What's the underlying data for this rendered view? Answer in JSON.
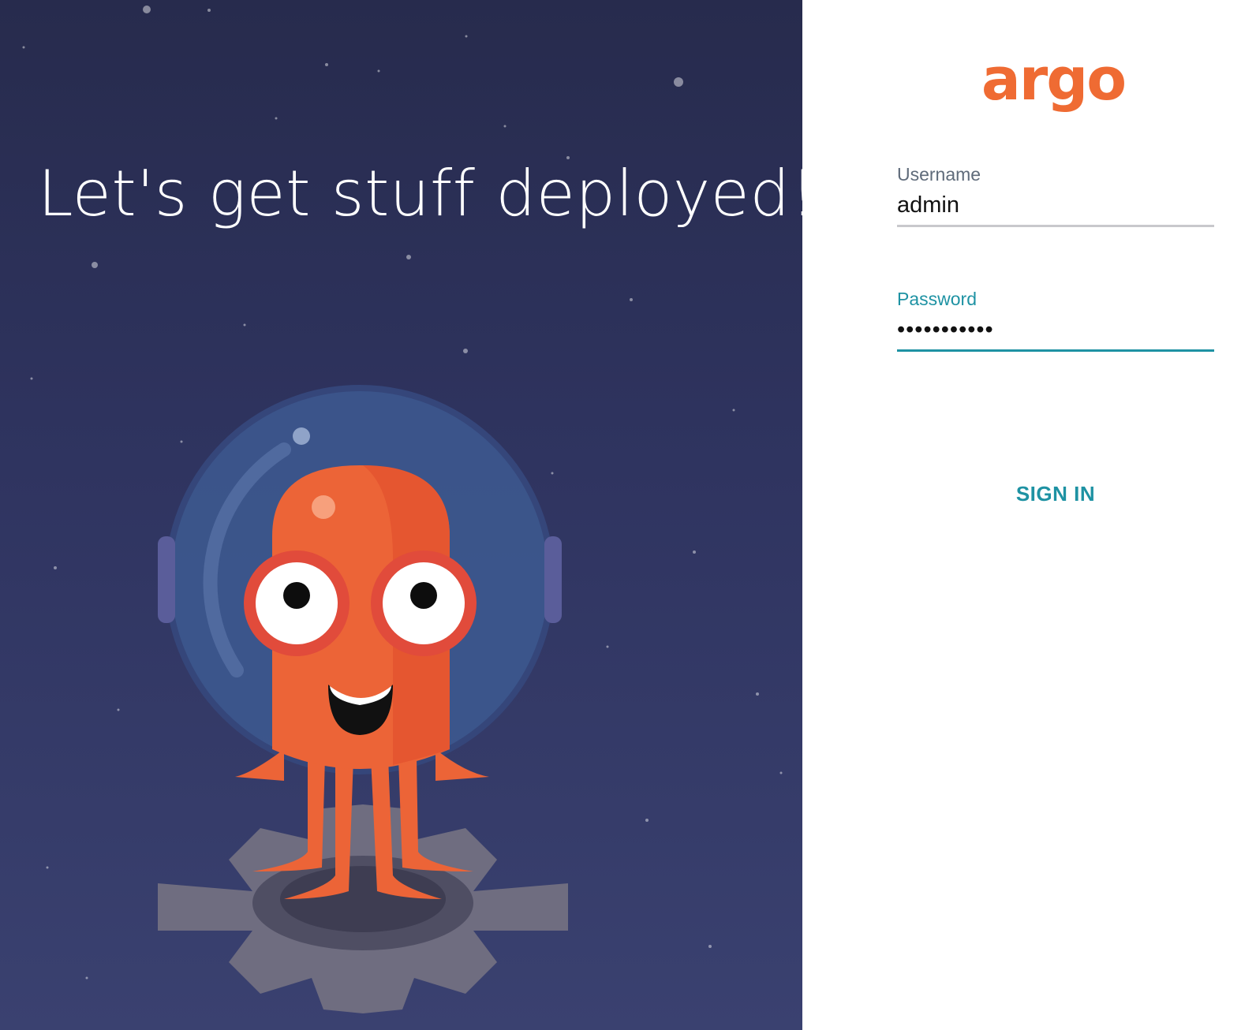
{
  "hero": {
    "title": "Let's get stuff deployed!"
  },
  "brand": {
    "logo_text": "argo",
    "accent": "#ef6b33"
  },
  "form": {
    "username_label": "Username",
    "username_value": "admin",
    "password_label": "Password",
    "password_value": "•••••••••••",
    "submit_label": "SIGN IN",
    "focus_color": "#1e92a3"
  },
  "icons": {
    "mascot": "argo-octopus-astronaut-icon",
    "gear": "gear-icon"
  }
}
